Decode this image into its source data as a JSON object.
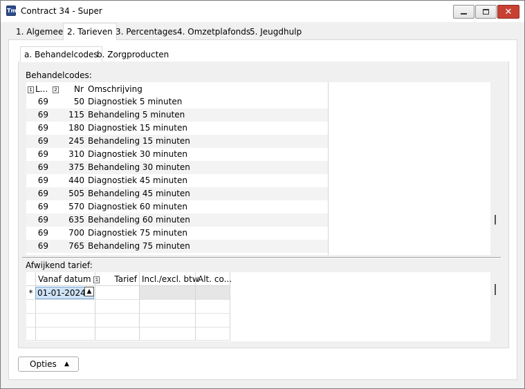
{
  "window": {
    "title": "Contract 34 - Super",
    "icon": "app-icon"
  },
  "tabs": [
    {
      "label": "1. Algemeen"
    },
    {
      "label": "2. Tarieven"
    },
    {
      "label": "3. Percentages"
    },
    {
      "label": "4. Omzetplafonds"
    },
    {
      "label": "5. Jeugdhulp"
    }
  ],
  "subtabs": [
    {
      "label": "a. Behandelcodes"
    },
    {
      "label": "b. Zorgproducten"
    }
  ],
  "behandelcodes": {
    "label": "Behandelcodes:",
    "columns": {
      "l": "L...",
      "nr": "Nr",
      "omschrijving": "Omschrijving",
      "sort1": "1",
      "sort2": "2"
    },
    "rows": [
      {
        "l": "69",
        "nr": "50",
        "omschrijving": "Diagnostiek 5 minuten"
      },
      {
        "l": "69",
        "nr": "115",
        "omschrijving": "Behandeling 5 minuten"
      },
      {
        "l": "69",
        "nr": "180",
        "omschrijving": "Diagnostiek 15 minuten"
      },
      {
        "l": "69",
        "nr": "245",
        "omschrijving": "Behandeling 15 minuten"
      },
      {
        "l": "69",
        "nr": "310",
        "omschrijving": "Diagnostiek 30 minuten"
      },
      {
        "l": "69",
        "nr": "375",
        "omschrijving": "Behandeling 30 minuten"
      },
      {
        "l": "69",
        "nr": "440",
        "omschrijving": "Diagnostiek 45 minuten"
      },
      {
        "l": "69",
        "nr": "505",
        "omschrijving": "Behandeling 45 minuten"
      },
      {
        "l": "69",
        "nr": "570",
        "omschrijving": "Diagnostiek 60 minuten"
      },
      {
        "l": "69",
        "nr": "635",
        "omschrijving": "Behandeling 60 minuten"
      },
      {
        "l": "69",
        "nr": "700",
        "omschrijving": "Diagnostiek 75 minuten"
      },
      {
        "l": "69",
        "nr": "765",
        "omschrijving": "Behandeling 75 minuten"
      }
    ]
  },
  "afwijkend": {
    "label": "Afwijkend tarief:",
    "columns": {
      "vanaf": "Vanaf datum",
      "sort": "1",
      "tarief": "Tarief",
      "incl": "Incl./excl. btw",
      "alt": "Alt. co..."
    },
    "new_row_marker": "*",
    "vanaf_value": "01-01-2024"
  },
  "footer": {
    "opties_label": "Opties",
    "opties_arrow": "▲"
  }
}
